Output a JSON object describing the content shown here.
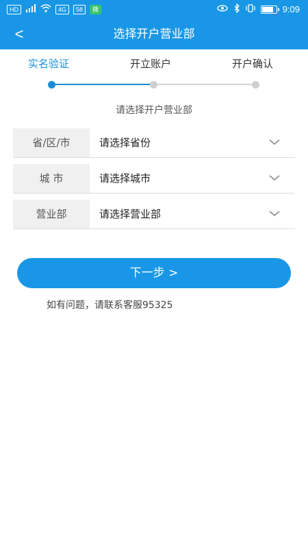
{
  "status_bar": {
    "chip_hd": "HD",
    "chip_4g": "4G",
    "chip_speed": "58",
    "chip_green": "微",
    "time": "9:09"
  },
  "header": {
    "back_label": "<",
    "title": "选择开户营业部"
  },
  "steps": [
    {
      "label": "实名验证",
      "state": "active"
    },
    {
      "label": "开立账户",
      "state": "pending"
    },
    {
      "label": "开户确认",
      "state": "pending"
    }
  ],
  "form": {
    "section_title": "请选择开户营业部",
    "rows": [
      {
        "label": "省/区/市",
        "value": "请选择省份"
      },
      {
        "label": "城 市",
        "value": "请选择城市"
      },
      {
        "label": "营业部",
        "value": "请选择营业部"
      }
    ]
  },
  "actions": {
    "next_label": "下一步 >"
  },
  "footer": {
    "help_text": "如有问题，请联系客服95325"
  },
  "colors": {
    "brand": "#1997e6",
    "step_active": "#1a93d8",
    "step_inactive": "#cfcfcf"
  }
}
